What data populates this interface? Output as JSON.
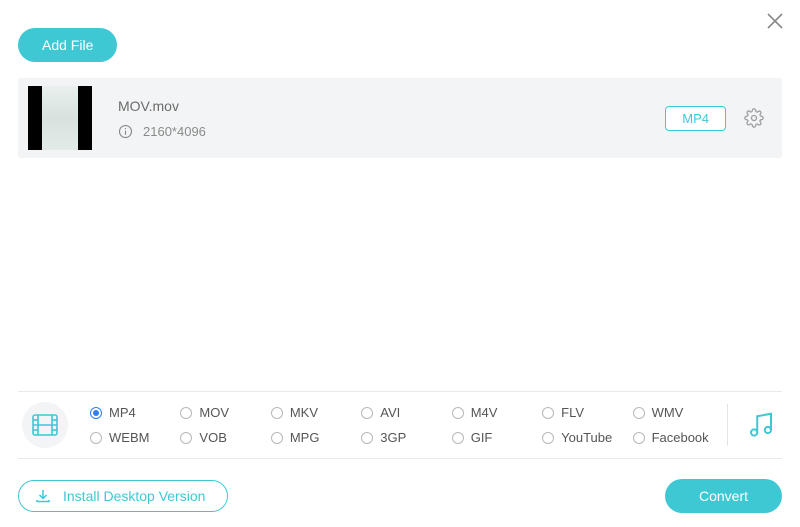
{
  "header": {
    "add_file_label": "Add File"
  },
  "file": {
    "name": "MOV.mov",
    "resolution": "2160*4096",
    "target_format": "MP4"
  },
  "formats": {
    "selected": "MP4",
    "options": [
      "MP4",
      "MOV",
      "MKV",
      "AVI",
      "M4V",
      "FLV",
      "WMV",
      "WEBM",
      "VOB",
      "MPG",
      "3GP",
      "GIF",
      "YouTube",
      "Facebook"
    ]
  },
  "footer": {
    "install_label": "Install Desktop Version",
    "convert_label": "Convert"
  },
  "colors": {
    "accent": "#3ec8d4",
    "radio_selected": "#2d7ff5"
  }
}
